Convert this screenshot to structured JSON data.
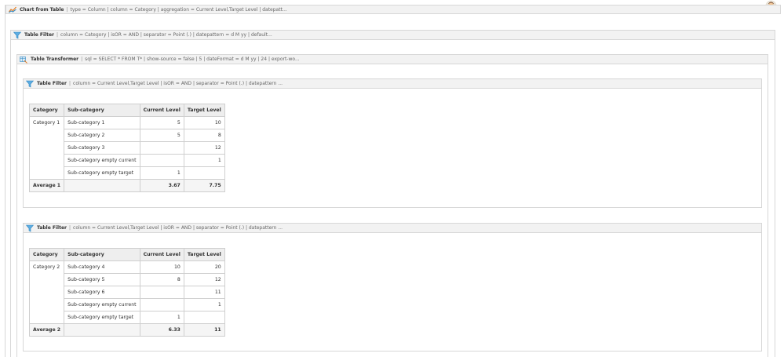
{
  "chart_macro": {
    "title": "Chart from Table",
    "params": "type = Column | column = Category | aggregation = Current Level,Target Level | datepatt..."
  },
  "outer_filter": {
    "title": "Table Filter",
    "params": "column = Category | isOR = AND | separator = Point (.) | datepattern = d M yy | default..."
  },
  "transformer": {
    "title": "Table Transformer",
    "params": "sql = SELECT * FROM T* | show-source = false | 5 | dateFormat = d M yy | 24 | export-wo..."
  },
  "filters": [
    {
      "title": "Table Filter",
      "params": "column = Current Level,Target Level | isOR = AND | separator = Point (.) | datepattern ...",
      "table": {
        "headers": [
          "Category",
          "Sub-category",
          "Current Level",
          "Target Level"
        ],
        "category": "Category 1",
        "rows": [
          {
            "sub": "Sub-category 1",
            "current": "5",
            "target": "10"
          },
          {
            "sub": "Sub-category 2",
            "current": "5",
            "target": "8"
          },
          {
            "sub": "Sub-category 3",
            "current": "",
            "target": "12"
          },
          {
            "sub": "Sub-category empty current",
            "current": "",
            "target": "1"
          },
          {
            "sub": "Sub-category empty target",
            "current": "1",
            "target": ""
          }
        ],
        "avg": {
          "label": "Average 1",
          "current": "3.67",
          "target": "7.75"
        }
      }
    },
    {
      "title": "Table Filter",
      "params": "column = Current Level,Target Level | isOR = AND | separator = Point (.) | datepattern ...",
      "table": {
        "headers": [
          "Category",
          "Sub-category",
          "Current Level",
          "Target Level"
        ],
        "category": "Category 2",
        "rows": [
          {
            "sub": "Sub-category 4",
            "current": "10",
            "target": "20"
          },
          {
            "sub": "Sub-category 5",
            "current": "8",
            "target": "12"
          },
          {
            "sub": "Sub-category 6",
            "current": "",
            "target": "11"
          },
          {
            "sub": "Sub-category empty current",
            "current": "",
            "target": "1"
          },
          {
            "sub": "Sub-category empty target",
            "current": "1",
            "target": ""
          }
        ],
        "avg": {
          "label": "Average 2",
          "current": "6.33",
          "target": "11"
        }
      }
    }
  ],
  "icons": {
    "chart": "line-chart-icon",
    "filter": "funnel-icon",
    "transformer": "table-transform-icon",
    "avatar": "user-avatar-icon"
  },
  "colors": {
    "header_bg": "#f2f2f2",
    "border": "#d7d7d7",
    "avatar_badge": "#3aa53a"
  }
}
